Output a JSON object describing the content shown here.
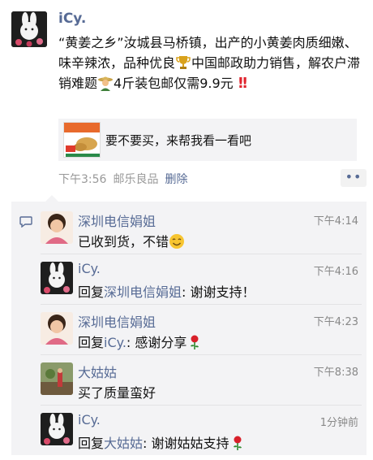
{
  "post": {
    "author": "iCy.",
    "text_part1": "“黄姜之乡”汝城县马桥镇，出产的小黄姜肉质细嫩、味辛辣浓，品种优良",
    "text_part2": "中国邮政助力销售，解农户滞销难题",
    "text_part3": "4斤装包邮仅需9.9元",
    "share_title": "要不要买，来帮我看一看吧",
    "time": "下午3:56",
    "source": "邮乐良品",
    "delete_label": "删除",
    "more_label": "••",
    "icons": [
      "trophy-icon",
      "farmer-icon",
      "double-exclamation-icon"
    ]
  },
  "comments": [
    {
      "name": "深圳电信娟姐",
      "time": "下午4:14",
      "text": "已收到货，不错",
      "emoji": "smile-icon"
    },
    {
      "name": "iCy.",
      "time": "下午4:16",
      "reply_prefix": "回复",
      "reply_to": "深圳电信娟姐",
      "text": ": 谢谢支持！"
    },
    {
      "name": "深圳电信娟姐",
      "time": "下午4:23",
      "reply_prefix": "回复",
      "reply_to": "iCy.",
      "text": ": 感谢分享",
      "emoji": "rose-icon"
    },
    {
      "name": "大姑姑",
      "time": "下午8:38",
      "text": "买了质量蛮好"
    },
    {
      "name": "iCy.",
      "time": "1分钟前",
      "reply_prefix": "回复",
      "reply_to": "大姑姑",
      "text": ": 谢谢姑姑支持",
      "emoji": "rose-icon"
    }
  ],
  "colors": {
    "link": "#576b95",
    "panel": "#f3f3f5",
    "accent_red": "#e0242d"
  }
}
